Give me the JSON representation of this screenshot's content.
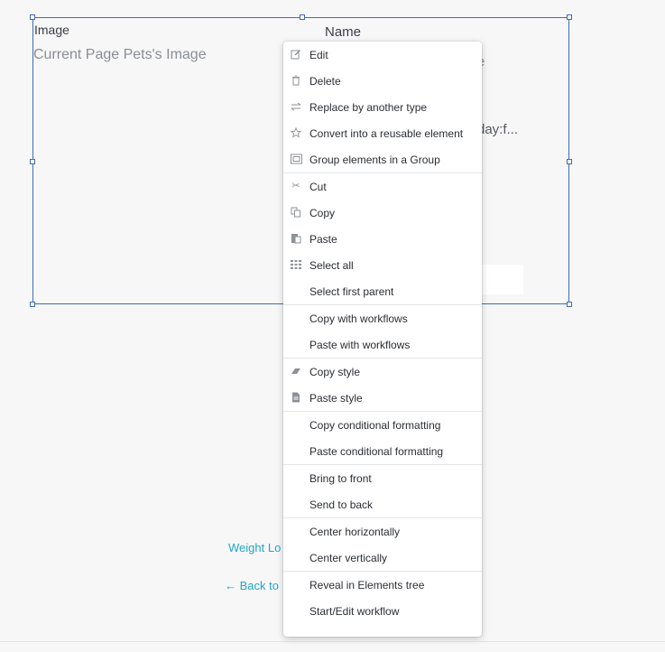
{
  "canvas": {
    "image_label": "Image",
    "image_placeholder": "Current Page Pets's Image",
    "name_label": "Name",
    "partial_text_1": "e",
    "partial_text_2": "day:f...",
    "weight_link": "Weight Lo",
    "back_link": "← Back to"
  },
  "menu": {
    "groups": [
      [
        {
          "label": "Edit",
          "icon": "pencil-icon"
        },
        {
          "label": "Delete",
          "icon": "trash-icon"
        },
        {
          "label": "Replace by another type",
          "icon": "swap-icon"
        },
        {
          "label": "Convert into a reusable element",
          "icon": "star-icon"
        },
        {
          "label": "Group elements in a Group",
          "icon": "group-icon"
        }
      ],
      [
        {
          "label": "Cut",
          "icon": "scissors-icon"
        },
        {
          "label": "Copy",
          "icon": "copy-icon"
        },
        {
          "label": "Paste",
          "icon": "paste-icon"
        },
        {
          "label": "Select all",
          "icon": "grid-icon"
        },
        {
          "label": "Select first parent",
          "icon": ""
        }
      ],
      [
        {
          "label": "Copy with workflows",
          "icon": ""
        },
        {
          "label": "Paste with workflows",
          "icon": ""
        }
      ],
      [
        {
          "label": "Copy style",
          "icon": "eraser-icon"
        },
        {
          "label": "Paste style",
          "icon": "document-icon"
        }
      ],
      [
        {
          "label": "Copy conditional formatting",
          "icon": ""
        },
        {
          "label": "Paste conditional formatting",
          "icon": ""
        }
      ],
      [
        {
          "label": "Bring to front",
          "icon": ""
        },
        {
          "label": "Send to back",
          "icon": ""
        }
      ],
      [
        {
          "label": "Center horizontally",
          "icon": ""
        },
        {
          "label": "Center vertically",
          "icon": ""
        }
      ],
      [
        {
          "label": "Reveal in Elements tree",
          "icon": ""
        },
        {
          "label": "Start/Edit workflow",
          "icon": ""
        }
      ]
    ]
  },
  "colors": {
    "selection": "#3d6cb8",
    "link": "#22a6c3",
    "background": "#f7f7f8"
  }
}
